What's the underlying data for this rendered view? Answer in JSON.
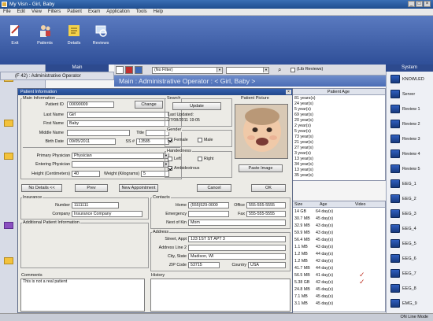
{
  "titlebar": {
    "title": "My Visn - Girl, Baby"
  },
  "menubar": {
    "items": [
      "File",
      "Edit",
      "View",
      "Filters",
      "Patient",
      "Exam",
      "Application",
      "Tools",
      "Help"
    ]
  },
  "toolbar": {
    "buttons": [
      "Exit",
      "Patients",
      "Details",
      "Reviews"
    ]
  },
  "main": {
    "panel_header": "Main",
    "left_header": "(F 42) : Administrative Operator",
    "subheader": "Main : Administrative Operator : < Girl, Baby >",
    "filter_value": "(No Filter)",
    "filter_check_label": "(Lib Reviews)",
    "grid_header": "Patient Age",
    "ages": [
      "81 years(s)",
      "24 year(s)",
      "5 year(s)",
      "69 year(s)",
      "20 year(s)",
      "2 year(s)",
      "5 year(s)",
      "73 year(s)",
      "21 year(s)",
      "27 year(s)",
      "3 year(s)",
      "13 year(s)",
      "34 year(s)",
      "13 year(s)",
      "35 year(s)"
    ],
    "lower_grid_headers": [
      "Size",
      "Age",
      "Video"
    ],
    "lower_rows": [
      {
        "size": "14 GB",
        "age": "64 day(s)"
      },
      {
        "size": "30.7 MB",
        "age": "45 day(s)"
      },
      {
        "size": "32.9 MB",
        "age": "43 day(s)"
      },
      {
        "size": "59.9 MB",
        "age": "43 day(s)"
      },
      {
        "size": "56.4 MB",
        "age": "45 day(s)"
      },
      {
        "size": "1.1 MB",
        "age": "43 day(s)"
      },
      {
        "size": "1.2 MB",
        "age": "44 day(s)"
      },
      {
        "size": "1.2 MB",
        "age": "42 day(s)"
      },
      {
        "size": "41.7 MB",
        "age": "44 day(s)"
      },
      {
        "size": "56.5 MB",
        "age": "41 day(s)"
      },
      {
        "size": "5.38 GB",
        "age": "42 day(s)"
      },
      {
        "size": "24.8 MB",
        "age": "45 day(s)"
      },
      {
        "size": "7.1 MB",
        "age": "45 day(s)"
      },
      {
        "size": "3.1 MB",
        "age": "45 day(s)"
      }
    ]
  },
  "system": {
    "header": "System",
    "items": [
      "KNOWLED",
      "Server",
      "Review 1",
      "Review 2",
      "Review 3",
      "Review 4",
      "Review 5",
      "EEG_1",
      "EEG_2",
      "EEG_3",
      "EEG_4",
      "EEG_5",
      "EEG_6",
      "EEG_7",
      "EEG_8",
      "EMG_9"
    ]
  },
  "status": {
    "right": "ON Line Mode"
  },
  "dialog": {
    "title": "Patient Information",
    "main_info": "Main Information",
    "patient_id_label": "Patient ID",
    "patient_id": "00090009",
    "change": "Change",
    "last_name_label": "Last Name",
    "last_name": "Girl",
    "first_name_label": "First Name",
    "first_name": "Baby",
    "middle_name_label": "Middle Name",
    "middle_name": "",
    "title_label": "Title",
    "title_val": "",
    "birth_date_label": "Birth Date",
    "birth_date": "09/05/2011",
    "ss_label": "SS #",
    "ss": "13585",
    "primary_label": "Primary Physician",
    "primary": "Physician",
    "entering_label": "Entering Physician",
    "entering": "",
    "height_label": "Height (Centimeters)",
    "height": "40",
    "weight_label": "Weight (Kilograms)",
    "weight": "5",
    "search": "Search",
    "update": "Update",
    "last_updated_label": "Last Updated:",
    "last_updated": "07/08/2011 19:05",
    "gender": "Gender",
    "female": "Female",
    "male": "Male",
    "handedness": "Handedness",
    "left": "Left",
    "right": "Right",
    "ambidextrous": "Ambidextrous",
    "patient_picture": "Patient Picture",
    "paste_image": "Paste Image",
    "no_details": "No Details <<",
    "prev": "Prev",
    "new_appt": "New Appointment",
    "cancel": "Cancel",
    "ok": "OK",
    "insurance": "Insurance",
    "number_label": "Number",
    "number": "1111111",
    "company_label": "Company",
    "company": "Insurance Company",
    "contacts": "Contacts",
    "home_label": "Home",
    "home": "(555)529-0000",
    "office_label": "Office",
    "office": "555-555-5555",
    "emergency_label": "Emergency",
    "emergency": "",
    "fax_label": "Fax",
    "fax": "555-555-5555",
    "next_of_kin_label": "Next of Kin",
    "next_of_kin": "Mom",
    "additional": "Additional Patient Information",
    "address": "Address",
    "street_label": "Street, Appt",
    "street": "123 1ST ST APT 3",
    "address2_label": "Address Line 2",
    "address2": "",
    "city_label": "City, State",
    "city": "Madison, WI",
    "zip_label": "ZIP Code",
    "zip": "53715",
    "country_label": "Country",
    "country": "USA",
    "comments": "Comments",
    "comments_text": "This is not a real patient",
    "history": "History"
  }
}
